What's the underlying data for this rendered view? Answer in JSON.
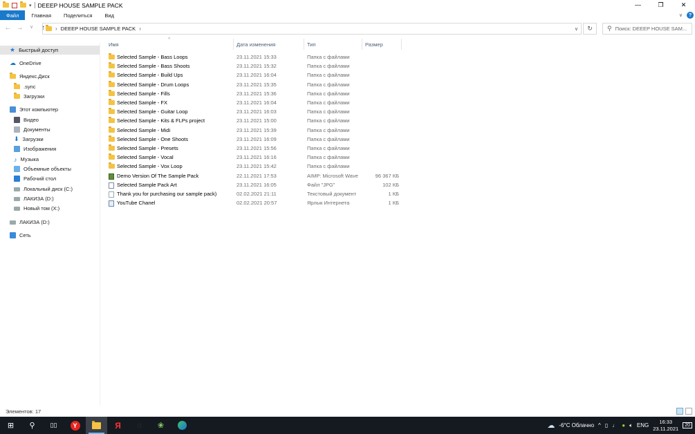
{
  "window": {
    "title": "DEEEP HOUSE SAMPLE PACK"
  },
  "ribbon": {
    "tabs": [
      "Файл",
      "Главная",
      "Поделиться",
      "Вид"
    ]
  },
  "address": {
    "path": "DEEEP HOUSE SAMPLE PACK"
  },
  "search": {
    "placeholder": "Поиск: DEEEP HOUSE SAM..."
  },
  "sidebar": {
    "items": [
      {
        "label": "Быстрый доступ",
        "icon": "star-icon"
      },
      {
        "label": "OneDrive",
        "icon": "cloud-icon"
      },
      {
        "label": "Яндекс.Диск",
        "icon": "folder-icon"
      },
      {
        "label": ".sync",
        "icon": "folder-icon"
      },
      {
        "label": "Загрузки",
        "icon": "folder-icon"
      },
      {
        "label": "Этот компьютер",
        "icon": "computer-icon"
      },
      {
        "label": "Видео",
        "icon": "video-icon"
      },
      {
        "label": "Документы",
        "icon": "documents-icon"
      },
      {
        "label": "Загрузки",
        "icon": "download-icon"
      },
      {
        "label": "Изображения",
        "icon": "pictures-icon"
      },
      {
        "label": "Музыка",
        "icon": "music-icon"
      },
      {
        "label": "Объемные объекты",
        "icon": "3d-objects-icon"
      },
      {
        "label": "Рабочий стол",
        "icon": "desktop-icon"
      },
      {
        "label": "Локальный диск (C:)",
        "icon": "drive-icon"
      },
      {
        "label": "ЛАКИЗА (D:)",
        "icon": "drive-icon"
      },
      {
        "label": "Новый том (X:)",
        "icon": "drive-icon"
      },
      {
        "label": "ЛАКИЗА (D:)",
        "icon": "drive-icon"
      },
      {
        "label": "Сеть",
        "icon": "network-icon"
      }
    ]
  },
  "columns": {
    "name": "Имя",
    "date": "Дата изменения",
    "type": "Тип",
    "size": "Размер"
  },
  "files": [
    {
      "name": "Selected Sample - Bass Loops",
      "date": "23.11.2021 15:33",
      "type": "Папка с файлами",
      "size": "",
      "icon": "folder-icon"
    },
    {
      "name": "Selected Sample - Bass Shoots",
      "date": "23.11.2021 15:32",
      "type": "Папка с файлами",
      "size": "",
      "icon": "folder-icon"
    },
    {
      "name": "Selected Sample - Build Ups",
      "date": "23.11.2021 16:04",
      "type": "Папка с файлами",
      "size": "",
      "icon": "folder-icon"
    },
    {
      "name": "Selected Sample - Drum Loops",
      "date": "23.11.2021 15:35",
      "type": "Папка с файлами",
      "size": "",
      "icon": "folder-icon"
    },
    {
      "name": "Selected Sample - Fills",
      "date": "23.11.2021 15:36",
      "type": "Папка с файлами",
      "size": "",
      "icon": "folder-icon"
    },
    {
      "name": "Selected Sample - FX",
      "date": "23.11.2021 16:04",
      "type": "Папка с файлами",
      "size": "",
      "icon": "folder-icon"
    },
    {
      "name": "Selected Sample - Guitar Loop",
      "date": "23.11.2021 16:03",
      "type": "Папка с файлами",
      "size": "",
      "icon": "folder-icon"
    },
    {
      "name": "Selected Sample - Kits & FLPs project",
      "date": "23.11.2021 15:00",
      "type": "Папка с файлами",
      "size": "",
      "icon": "folder-icon"
    },
    {
      "name": "Selected Sample - Midi",
      "date": "23.11.2021 15:39",
      "type": "Папка с файлами",
      "size": "",
      "icon": "folder-icon"
    },
    {
      "name": "Selected Sample - One Shoots",
      "date": "23.11.2021 16:09",
      "type": "Папка с файлами",
      "size": "",
      "icon": "folder-icon"
    },
    {
      "name": "Selected Sample - Presets",
      "date": "23.11.2021 15:56",
      "type": "Папка с файлами",
      "size": "",
      "icon": "folder-icon"
    },
    {
      "name": "Selected Sample - Vocal",
      "date": "23.11.2021 16:16",
      "type": "Папка с файлами",
      "size": "",
      "icon": "folder-icon"
    },
    {
      "name": "Selected Sample - Vox Loop",
      "date": "23.11.2021 15:42",
      "type": "Папка с файлами",
      "size": "",
      "icon": "folder-icon"
    },
    {
      "name": "Demo Version Of The Sample Pack",
      "date": "22.11.2021 17:53",
      "type": "AIMP: Microsoft Wave",
      "size": "96 367 КБ",
      "icon": "audio-file-icon"
    },
    {
      "name": "Selected Sample Pack Art",
      "date": "23.11.2021 16:05",
      "type": "Файл \"JPG\"",
      "size": "102 КБ",
      "icon": "image-file-icon"
    },
    {
      "name": "Thank you for purchasing our sample pack)",
      "date": "02.02.2021 21:11",
      "type": "Текстовый документ",
      "size": "1 КБ",
      "icon": "text-file-icon"
    },
    {
      "name": "YouTube Chanel",
      "date": "02.02.2021 20:57",
      "type": "Ярлык Интернета",
      "size": "1 КБ",
      "icon": "internet-shortcut-icon"
    }
  ],
  "status": {
    "count": "Элементов: 17"
  },
  "taskbar": {
    "weather": "-6°C Облачно",
    "lang": "ENG",
    "time": "16:33",
    "date": "23.11.2021",
    "notifications": "20"
  },
  "colors": {
    "accent": "#1979ca",
    "folder": "#f5c342",
    "taskbar": "#151920"
  }
}
